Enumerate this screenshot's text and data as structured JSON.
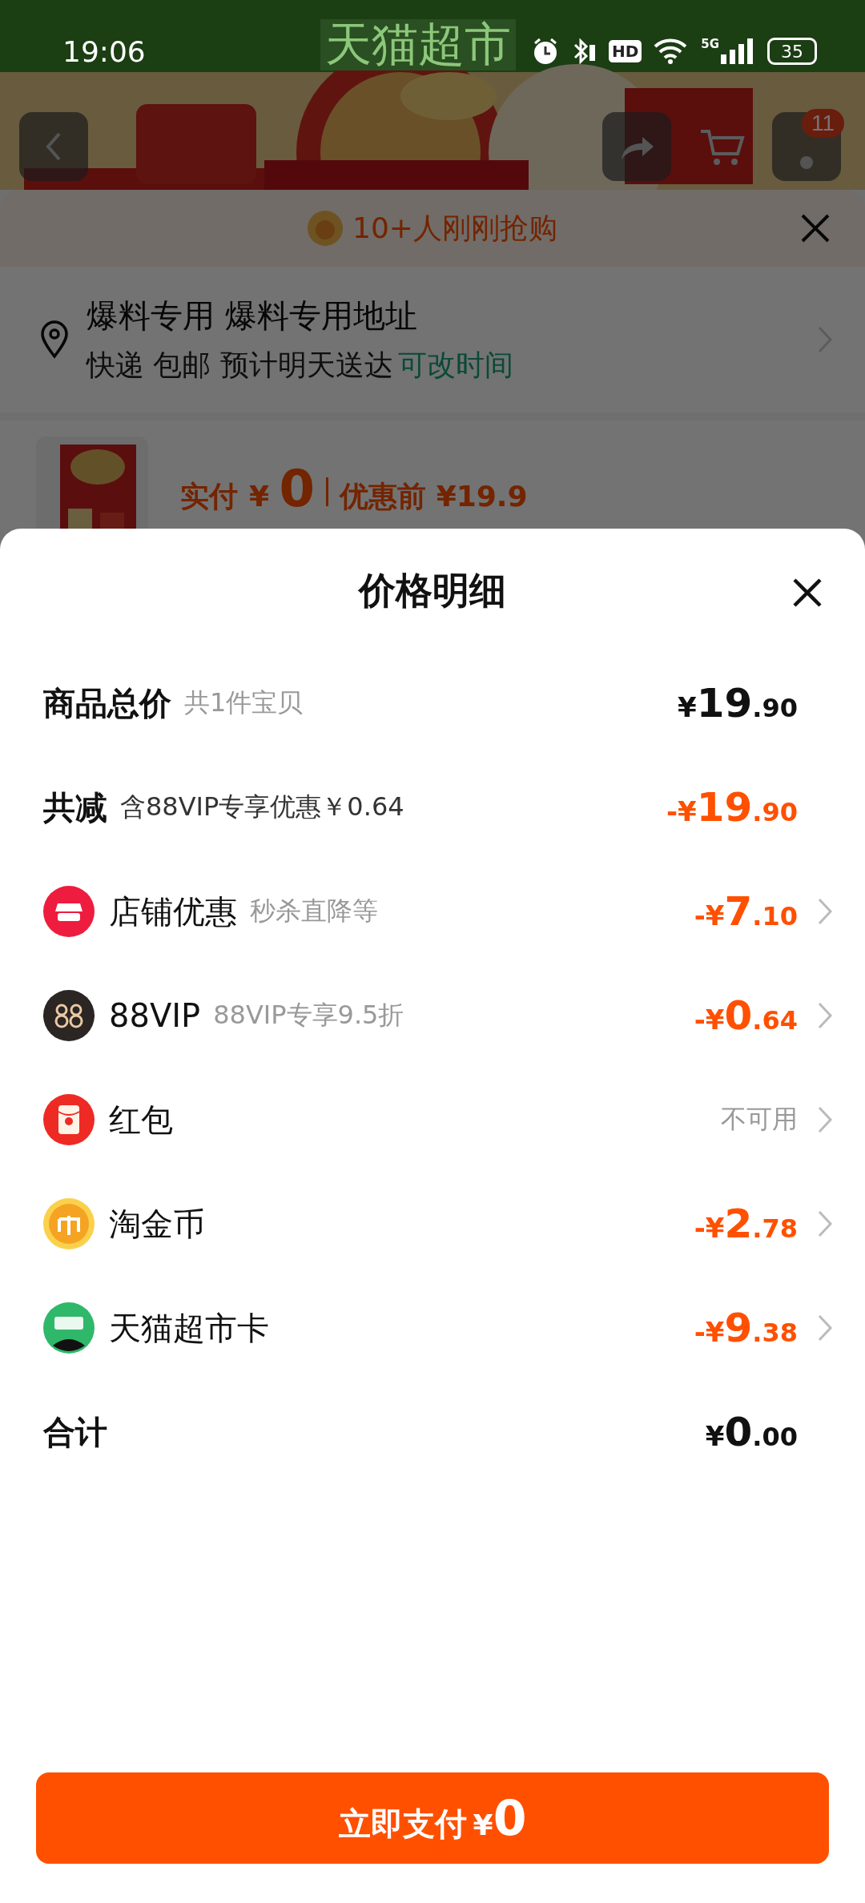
{
  "status_bar": {
    "time": "19:06",
    "hd": "HD",
    "network": "5G",
    "battery": "35"
  },
  "background_page": {
    "header_title": "天猫超市",
    "cart_badge": "11",
    "buyers_notice": "10+人刚刚抢购",
    "address": {
      "name": "爆料专用 爆料专用地址",
      "delivery": "快递 包邮 预计明天送达",
      "link": "可改时间"
    },
    "product": {
      "paid_label": "实付",
      "paid": "¥ 0",
      "before": "优惠前 ¥19.9"
    }
  },
  "price_sheet": {
    "title": "价格明细",
    "rows": [
      {
        "kind": "summary",
        "label": "商品总价",
        "note": "共1件宝贝",
        "note_muted": true,
        "amount": "¥19.90",
        "deduction": false,
        "disabled": false
      },
      {
        "kind": "summary",
        "label": "共减",
        "note": "含88VIP专享优惠￥0.64",
        "note_muted": false,
        "amount": "-¥19.90",
        "deduction": true,
        "disabled": false
      },
      {
        "kind": "shop",
        "label": "店铺优惠",
        "note": "秒杀直降等",
        "note_muted": true,
        "amount": "-¥7.10",
        "deduction": true,
        "disabled": false
      },
      {
        "kind": "vip",
        "label": "88VIP",
        "note": "88VIP专享9.5折",
        "note_muted": true,
        "amount": "-¥0.64",
        "deduction": true,
        "disabled": false
      },
      {
        "kind": "redpacket",
        "label": "红包",
        "amount": "不可用",
        "deduction": false,
        "disabled": true
      },
      {
        "kind": "coin",
        "label": "淘金币",
        "amount": "-¥2.78",
        "deduction": true,
        "disabled": false
      },
      {
        "kind": "card",
        "label": "天猫超市卡",
        "amount": "-¥9.38",
        "deduction": true,
        "disabled": false
      },
      {
        "kind": "summary",
        "label": "合计",
        "amount": "¥0.00",
        "deduction": false,
        "disabled": false
      }
    ]
  },
  "pay_button": {
    "label": "立即支付",
    "amount": "¥0"
  }
}
